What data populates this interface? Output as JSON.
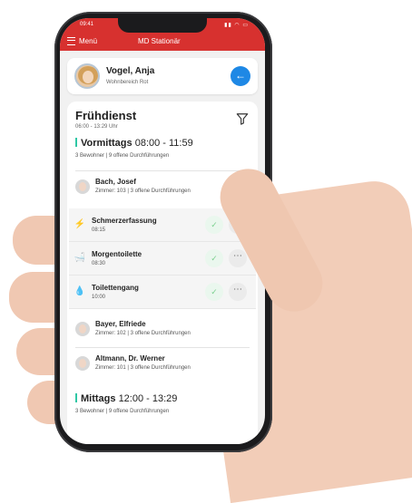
{
  "statusbar": {
    "time": "09:41",
    "icons": "▮▮ ◠ ▭"
  },
  "appbar": {
    "menu_label": "Menü",
    "title": "MD Stationär"
  },
  "profile": {
    "name": "Vogel, Anja",
    "unit": "Wohnbereich Rot"
  },
  "shift": {
    "title": "Frühdienst",
    "time": "06:00 - 13:29 Uhr"
  },
  "sections": [
    {
      "name": "Vormittags",
      "time": "08:00 - 11:59",
      "summary": "3 Bewohner | 9 offene Durchführungen"
    },
    {
      "name": "Mittags",
      "time": "12:00 - 13:29",
      "summary": "3 Bewohner | 9 offene Durchführungen"
    }
  ],
  "residents": [
    {
      "name": "Bach, Josef",
      "info": "Zimmer: 103 | 3 offene Durchführungen"
    },
    {
      "name": "Bayer, Elfriede",
      "info": "Zimmer: 102 | 3 offene Durchführungen"
    },
    {
      "name": "Altmann, Dr. Werner",
      "info": "Zimmer: 101 | 3 offene Durchführungen"
    }
  ],
  "tasks": [
    {
      "name": "Schmerzerfassung",
      "time": "08:15",
      "icon": "pain-icon"
    },
    {
      "name": "Morgentoilette",
      "time": "08:30",
      "icon": "bathtub-icon"
    },
    {
      "name": "Toilettengang",
      "time": "10:00",
      "icon": "droplets-icon"
    }
  ],
  "colors": {
    "brand": "#d7312f",
    "accent": "#2fc7a5",
    "action": "#1e88e5"
  }
}
